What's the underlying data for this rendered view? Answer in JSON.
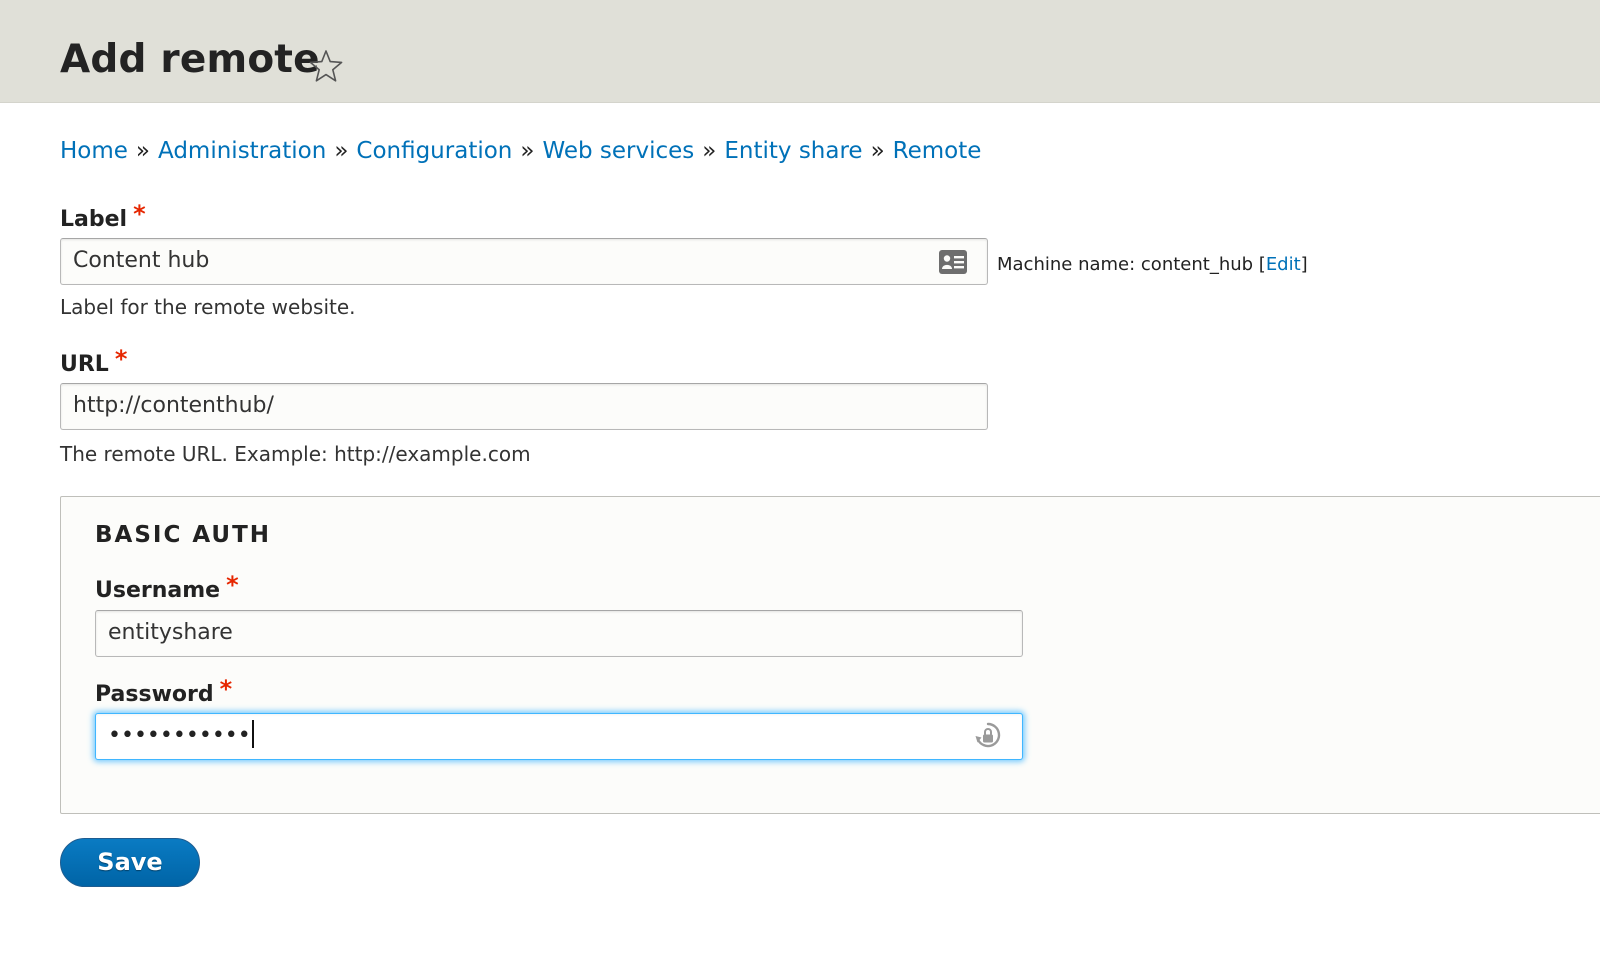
{
  "header": {
    "title": "Add remote",
    "favorite_icon": "star-outline-icon"
  },
  "breadcrumb": {
    "separator": "»",
    "items": [
      "Home",
      "Administration",
      "Configuration",
      "Web services",
      "Entity share",
      "Remote"
    ]
  },
  "form": {
    "label_field": {
      "label": "Label",
      "required_marker": "*",
      "value": "Content hub",
      "description": "Label for the remote website.",
      "icon": "contact-card-icon",
      "machine_name_prefix": "Machine name: content_hub [",
      "machine_name_edit": "Edit",
      "machine_name_suffix": "]"
    },
    "url_field": {
      "label": "URL",
      "required_marker": "*",
      "value": "http://contenthub/",
      "description": "The remote URL. Example: http://example.com"
    },
    "basic_auth": {
      "legend": "Basic Auth",
      "username": {
        "label": "Username",
        "required_marker": "*",
        "value": "entityshare"
      },
      "password": {
        "label": "Password",
        "required_marker": "*",
        "masked_value": "•••••••••••",
        "icon": "password-lock-icon"
      }
    },
    "save_label": "Save"
  },
  "colors": {
    "link": "#0071b8",
    "required": "#e62600",
    "header_bg": "#e0e0d8",
    "button_bg": "#0071b8",
    "focus_glow": "#40b6ff"
  }
}
